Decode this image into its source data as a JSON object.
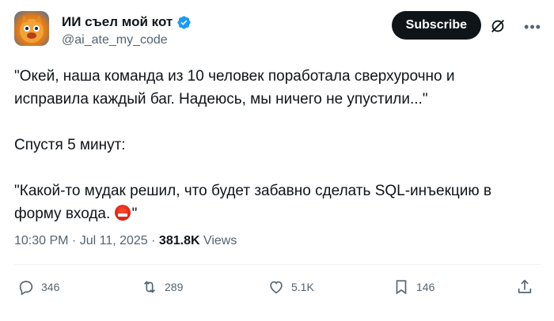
{
  "author": {
    "display_name": "ИИ съел мой кот",
    "handle": "@ai_ate_my_code",
    "avatar_icon": "cartoon-cat-avatar",
    "verified_icon": "verified-badge-icon",
    "verified_color": "#1d9bf0"
  },
  "header": {
    "subscribe_label": "Subscribe",
    "grok_icon": "grok-icon",
    "more_icon": "more-icon"
  },
  "tweet": {
    "line1": "\"Окей, наша команда из 10 человек поработала сверхурочно и",
    "line2": "исправила каждый баг. Надеюсь, мы ничего не упустили...\"",
    "line3": "Спустя 5 минут:",
    "line4": "\"Какой-то мудак решил, что будет забавно сделать SQL-инъекцию в",
    "line5_text": "форму входа. ",
    "line5_end": "\"",
    "emoji": "cursing-face-emoji"
  },
  "meta": {
    "time": "10:30 PM",
    "sep1": " · ",
    "date": "Jul 11, 2025",
    "sep2": " · ",
    "views_count": "381.8K",
    "views_label": " Views"
  },
  "actions": {
    "replies": "346",
    "reposts": "289",
    "likes": "5.1K",
    "bookmarks": "146"
  },
  "colors": {
    "text": "#0f1419",
    "secondary": "#536471",
    "divider": "#eff3f4",
    "subscribe_bg": "#0f1419"
  }
}
